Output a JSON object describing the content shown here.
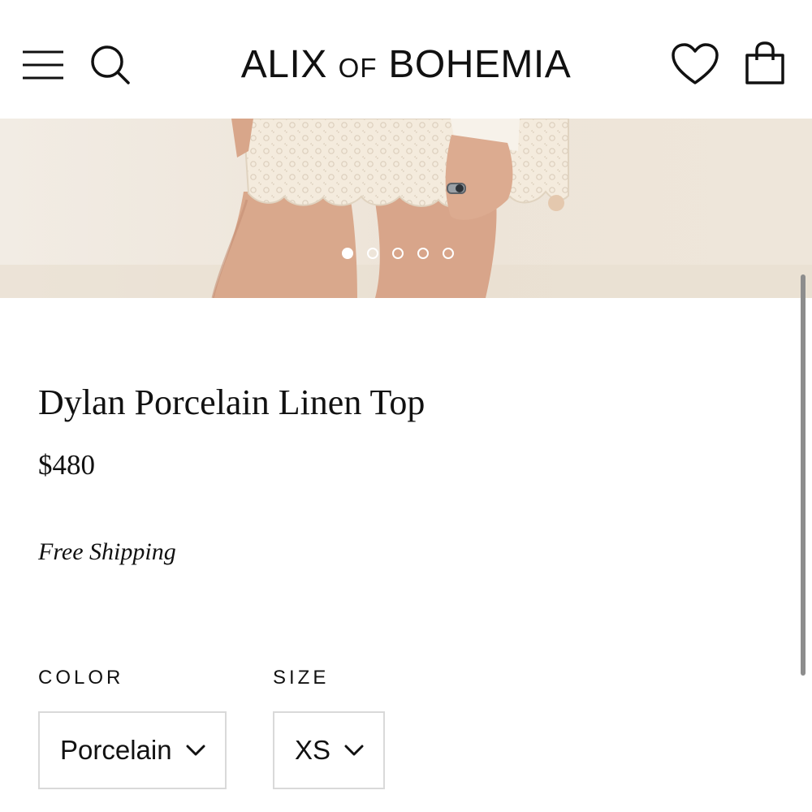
{
  "header": {
    "brand_main": "ALIX",
    "brand_of": "OF",
    "brand_tail": "BOHEMIA",
    "icons": [
      "menu-icon",
      "search-icon",
      "heart-icon",
      "shopping-bag-icon"
    ]
  },
  "gallery": {
    "slide_count": 5,
    "active_slide": 1
  },
  "product": {
    "title": "Dylan Porcelain Linen Top",
    "price": "$480",
    "shipping": "Free Shipping"
  },
  "options": {
    "color_label": "COLOR",
    "color_value": "Porcelain",
    "size_label": "SIZE",
    "size_value": "XS"
  },
  "colors": {
    "text": "#111111",
    "select_border": "#d9d9d9",
    "hero_background": "#efe8df",
    "crochet": "#f3e9da"
  }
}
